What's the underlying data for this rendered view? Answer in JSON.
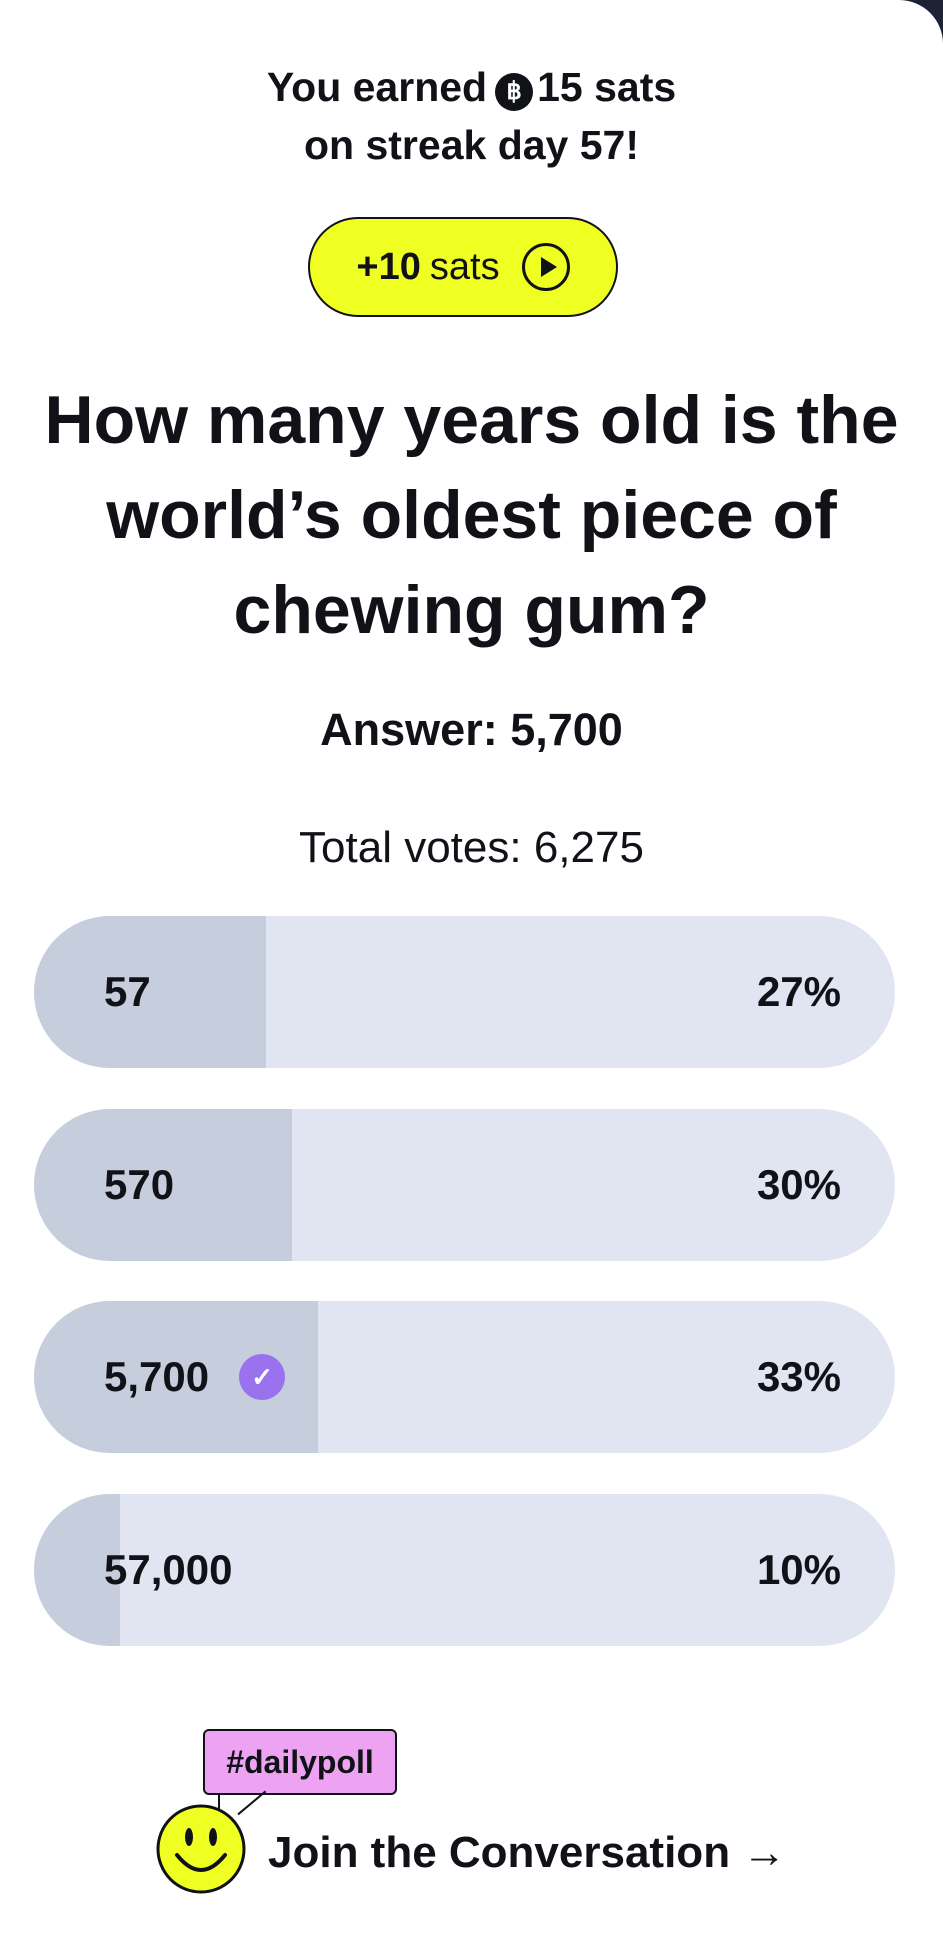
{
  "reward": {
    "line1_prefix": "You earned",
    "coin_symbol": "฿",
    "amount_text": "15 sats",
    "line2": "on streak day 57!"
  },
  "bonus_button": {
    "amount": "+10",
    "unit": "sats",
    "icon": "play-icon"
  },
  "question": "How many years old is the world’s oldest piece of chewing gum?",
  "answer": "Answer: 5,700",
  "total_votes": "Total votes: 6,275",
  "options": [
    {
      "label": "57",
      "percent": "27%",
      "fill": 0.27,
      "selected": false
    },
    {
      "label": "570",
      "percent": "30%",
      "fill": 0.3,
      "selected": false
    },
    {
      "label": "5,700",
      "percent": "33%",
      "fill": 0.33,
      "selected": true
    },
    {
      "label": "57,000",
      "percent": "10%",
      "fill": 0.1,
      "selected": false
    }
  ],
  "community": {
    "hashtag": "#dailypoll",
    "cta": "Join the Conversation →",
    "avatar_icon": "smiley-icon"
  },
  "colors": {
    "bonus_bg": "#f0ff22",
    "check": "#9a72ee",
    "bar_bg": "#e1e5f1",
    "bar_fill": "#c6cedd",
    "tag_bg": "#eda3f2",
    "smiley": "#f0ff22"
  }
}
